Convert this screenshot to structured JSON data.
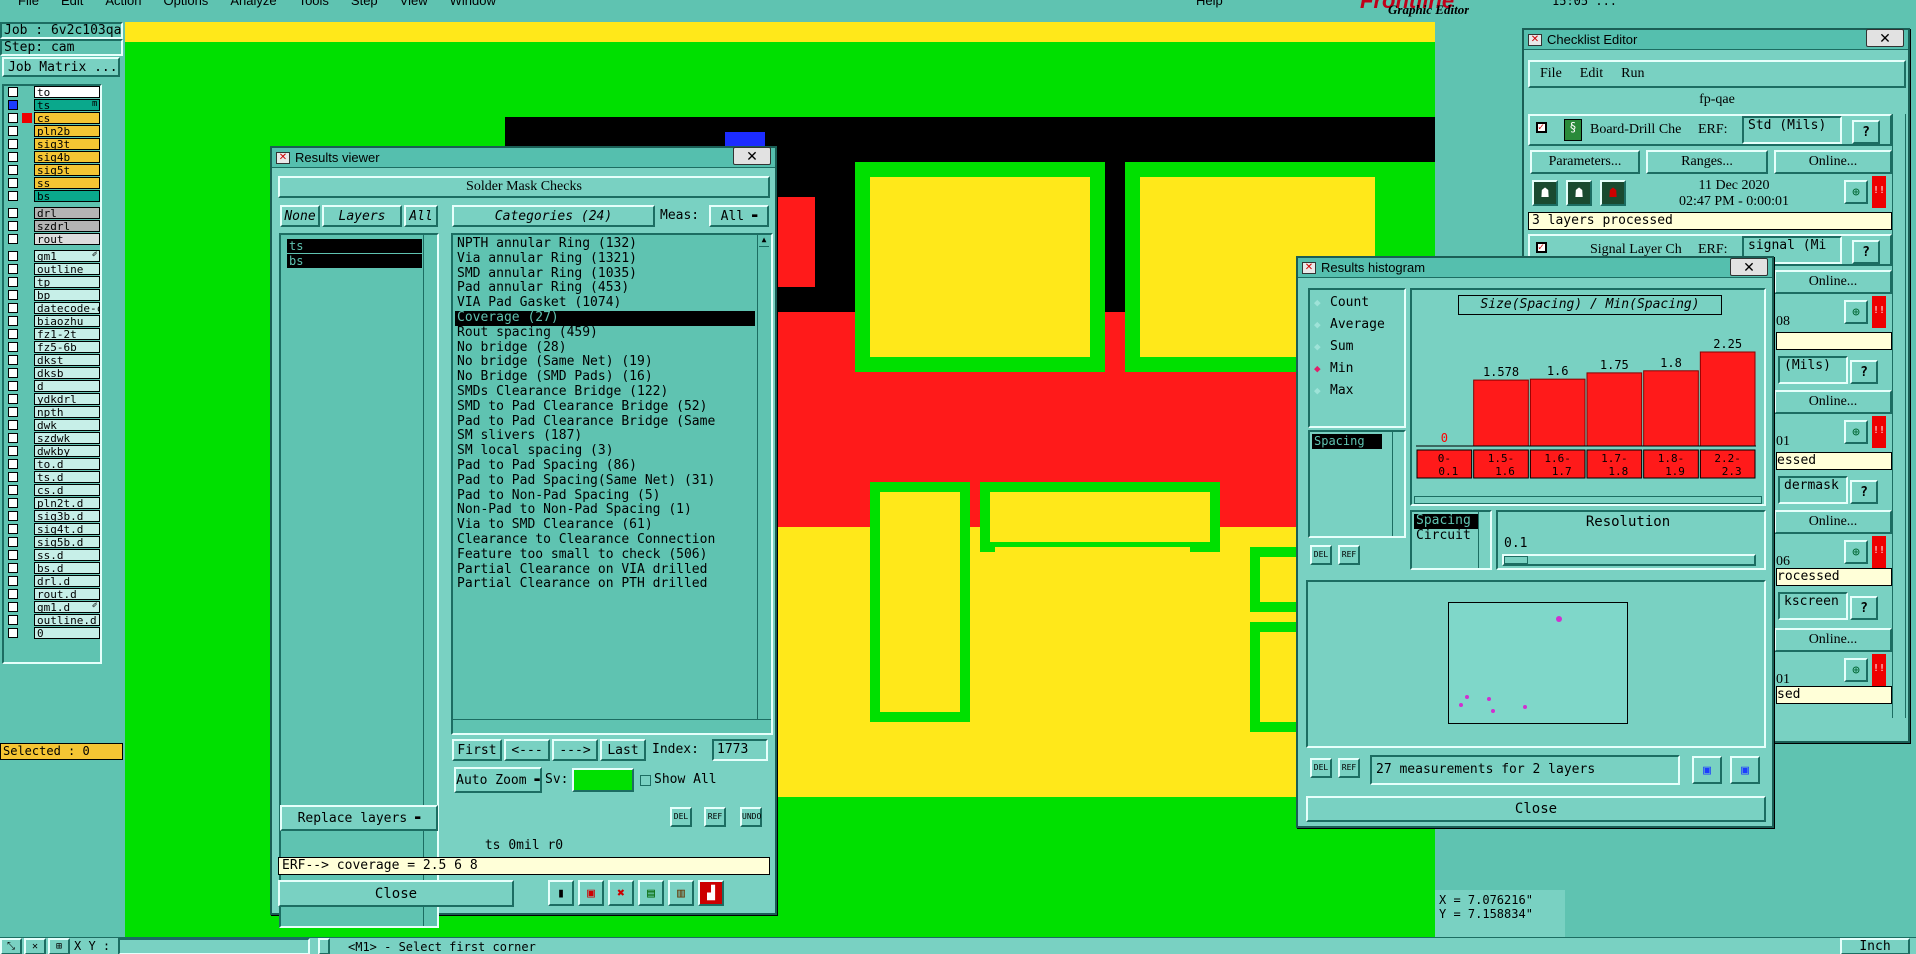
{
  "menubar": {
    "items": [
      "File",
      "Edit",
      "Action",
      "Options",
      "Analyze",
      "Tools",
      "Step",
      "View",
      "Window"
    ],
    "help": "Help",
    "brand": "Frontline",
    "clock": "15:05 ..."
  },
  "job": {
    "job": "Job : 6v2c103qa0",
    "step": "Step: cam",
    "matrix_button": "Job Matrix ..."
  },
  "layers": [
    {
      "name": "to",
      "color": "#ffffff"
    },
    {
      "name": "ts",
      "color": "#0aa88c",
      "marker": "m"
    },
    {
      "name": "cs",
      "color": "#f5c533"
    },
    {
      "name": "pln2b",
      "color": "#f5c533"
    },
    {
      "name": "sig3t",
      "color": "#f5c533"
    },
    {
      "name": "sig4b",
      "color": "#f5c533"
    },
    {
      "name": "sig5t",
      "color": "#f5c533"
    },
    {
      "name": "ss",
      "color": "#f5c533"
    },
    {
      "name": "bs",
      "color": "#0aa88c"
    },
    {
      "name": "drl",
      "color": "#b4b4b4"
    },
    {
      "name": "szdrl",
      "color": "#b4b4b4"
    },
    {
      "name": "rout",
      "color": "#dcdcdc"
    },
    {
      "name": "gm1",
      "color": "#c7efe8",
      "marker": "✐"
    },
    {
      "name": "outline",
      "color": "#c7efe8"
    },
    {
      "name": "tp",
      "color": "#c7efe8"
    },
    {
      "name": "bp",
      "color": "#c7efe8"
    },
    {
      "name": "datecode-cs",
      "color": "#c7efe8"
    },
    {
      "name": "biaozhu",
      "color": "#c7efe8"
    },
    {
      "name": "fz1-2t",
      "color": "#c7efe8"
    },
    {
      "name": "fz5-6b",
      "color": "#c7efe8"
    },
    {
      "name": "dkst",
      "color": "#c7efe8"
    },
    {
      "name": "dksb",
      "color": "#c7efe8"
    },
    {
      "name": "d",
      "color": "#c7efe8"
    },
    {
      "name": "ydkdrl",
      "color": "#c7efe8"
    },
    {
      "name": "npth",
      "color": "#c7efe8"
    },
    {
      "name": "dwk",
      "color": "#c7efe8"
    },
    {
      "name": "szdwk",
      "color": "#c7efe8"
    },
    {
      "name": "dwkby",
      "color": "#c7efe8"
    },
    {
      "name": "to.d",
      "color": "#c7efe8"
    },
    {
      "name": "ts.d",
      "color": "#c7efe8"
    },
    {
      "name": "cs.d",
      "color": "#c7efe8"
    },
    {
      "name": "pln2t.d",
      "color": "#c7efe8"
    },
    {
      "name": "sig3b.d",
      "color": "#c7efe8"
    },
    {
      "name": "sig4t.d",
      "color": "#c7efe8"
    },
    {
      "name": "sig5b.d",
      "color": "#c7efe8"
    },
    {
      "name": "ss.d",
      "color": "#c7efe8"
    },
    {
      "name": "bs.d",
      "color": "#c7efe8"
    },
    {
      "name": "drl.d",
      "color": "#c7efe8"
    },
    {
      "name": "rout.d",
      "color": "#c7efe8"
    },
    {
      "name": "gm1.d",
      "color": "#c7efe8",
      "marker": "✐"
    },
    {
      "name": "outline.d",
      "color": "#c7efe8"
    },
    {
      "name": "0",
      "color": "#c7efe8"
    }
  ],
  "selected": "Selected : 0",
  "bottombar": {
    "xy_label": "X Y :",
    "prompt": "<M1> - Select first corner",
    "units": "Inch"
  },
  "coords": {
    "x": "X = 7.076216\"",
    "y": "Y = 7.158834\""
  },
  "results_viewer": {
    "title": "Results viewer",
    "header": "Solder Mask Checks",
    "none_btn": "None",
    "layers_btn": "Layers",
    "all_btn": "All",
    "selected_layers": [
      "ts",
      "bs"
    ],
    "categories_btn": "Categories (24)",
    "meas_label": "Meas:",
    "meas_value": "All",
    "categories": [
      "NPTH annular Ring (132)",
      "Via annular Ring (1321)",
      "SMD annular Ring (1035)",
      "Pad annular Ring (453)",
      "VIA Pad Gasket (1074)",
      "Coverage (27)",
      "Rout spacing (459)",
      "No bridge (28)",
      "No bridge (Same Net) (19)",
      "No Bridge (SMD Pads) (16)",
      "SMDs Clearance Bridge (122)",
      "SMD to Pad Clearance Bridge (52)",
      "Pad to Pad Clearance Bridge (Same",
      "SM slivers (187)",
      "SM local spacing (3)",
      "Pad to Pad Spacing (86)",
      "Pad to Pad Spacing(Same Net) (31)",
      "Pad to Non-Pad Spacing (5)",
      "Non-Pad to Non-Pad Spacing (1)",
      "Via to SMD Clearance (61)",
      "Clearance to Clearance Connection",
      "Feature too small to check (506)",
      "Partial Clearance on VIA drilled",
      "Partial Clearance on PTH drilled"
    ],
    "selected_category": "Coverage (27)",
    "first_btn": "First",
    "prev_btn": "<---",
    "next_btn": "--->",
    "last_btn": "Last",
    "index_label": "Index:",
    "index_value": "1773",
    "autozoom": "Auto Zoom",
    "sv_label": "Sv:",
    "show_all": "Show All",
    "replace_layers": "Replace layers",
    "del": "DEL",
    "ref": "REF",
    "undo": "UNDO",
    "info": "ts 0mil   r0",
    "erf": "ERF--> coverage = 2.5 6 8",
    "close": "Close"
  },
  "histogram": {
    "title": "Results histogram",
    "options": [
      "Count",
      "Average",
      "Sum",
      "Min",
      "Max"
    ],
    "selected_option": "Min",
    "list_item": "Spacing",
    "del": "DEL",
    "ref": "REF",
    "chart_title": "Size(Spacing) / Min(Spacing)",
    "circuit_list": [
      "Spacing",
      "Circuit"
    ],
    "resolution_label": "Resolution",
    "resolution_value": "0.1",
    "status": "27 measurements for 2 layers",
    "close": "Close"
  },
  "chart_data": {
    "type": "bar",
    "title": "Size(Spacing) / Min(Spacing)",
    "categories": [
      "0-0.1",
      "1.5-1.6",
      "1.6-1.7",
      "1.7-1.8",
      "1.8-1.9",
      "2.2-2.3"
    ],
    "values": [
      0,
      1.578,
      1.6,
      1.75,
      1.8,
      2.25
    ],
    "value_labels": [
      "0",
      "1.578",
      "1.6",
      "1.75",
      "1.8",
      "2.25"
    ],
    "ylim": [
      0,
      2.25
    ],
    "bar_color": "#ff1a1a",
    "label_color": "#ff0000"
  },
  "checklist": {
    "title": "Checklist Editor",
    "graphic_editor": "Graphic Editor",
    "menu": [
      "File",
      "Edit",
      "Run"
    ],
    "name": "fp-qae",
    "board_check": "Board-Drill Che",
    "erf_label": "ERF:",
    "erf_value": "Std (Mils)",
    "help": "?",
    "parameters": "Parameters...",
    "ranges": "Ranges...",
    "online": "Online...",
    "date": "11 Dec 2020",
    "time": "02:47 PM - 0:00:01",
    "processed": "3 layers processed",
    "signal_check": "Signal Layer Ch",
    "signal_erf": "signal (Mi",
    "erf_cut": [
      "(Mils)",
      "dermask",
      "kscreen"
    ],
    "frag": [
      "08",
      "01",
      "06",
      "01"
    ],
    "processed_cut": [
      "essed",
      "rocessed",
      "sed"
    ]
  }
}
